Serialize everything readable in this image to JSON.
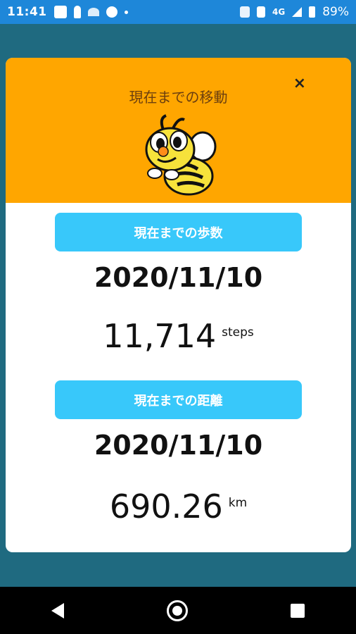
{
  "status_bar": {
    "time": "11:41",
    "network": "4G",
    "battery": "89%"
  },
  "dialog": {
    "title": "現在までの移動",
    "close_label": "×",
    "steps_section": {
      "button_label": "現在までの歩数",
      "date": "2020/11/10",
      "value": "11,714",
      "unit": "steps"
    },
    "distance_section": {
      "button_label": "現在までの距離",
      "date": "2020/11/10",
      "value": "690.26",
      "unit": "km"
    }
  },
  "colors": {
    "header_bg": "#ffa600",
    "button_bg": "#38c8fa",
    "backdrop": "#1f6a80",
    "status_bar": "#1e87d9"
  },
  "icons": [
    "bee-mascot-icon",
    "close-icon",
    "back-icon",
    "home-icon",
    "recents-icon"
  ]
}
